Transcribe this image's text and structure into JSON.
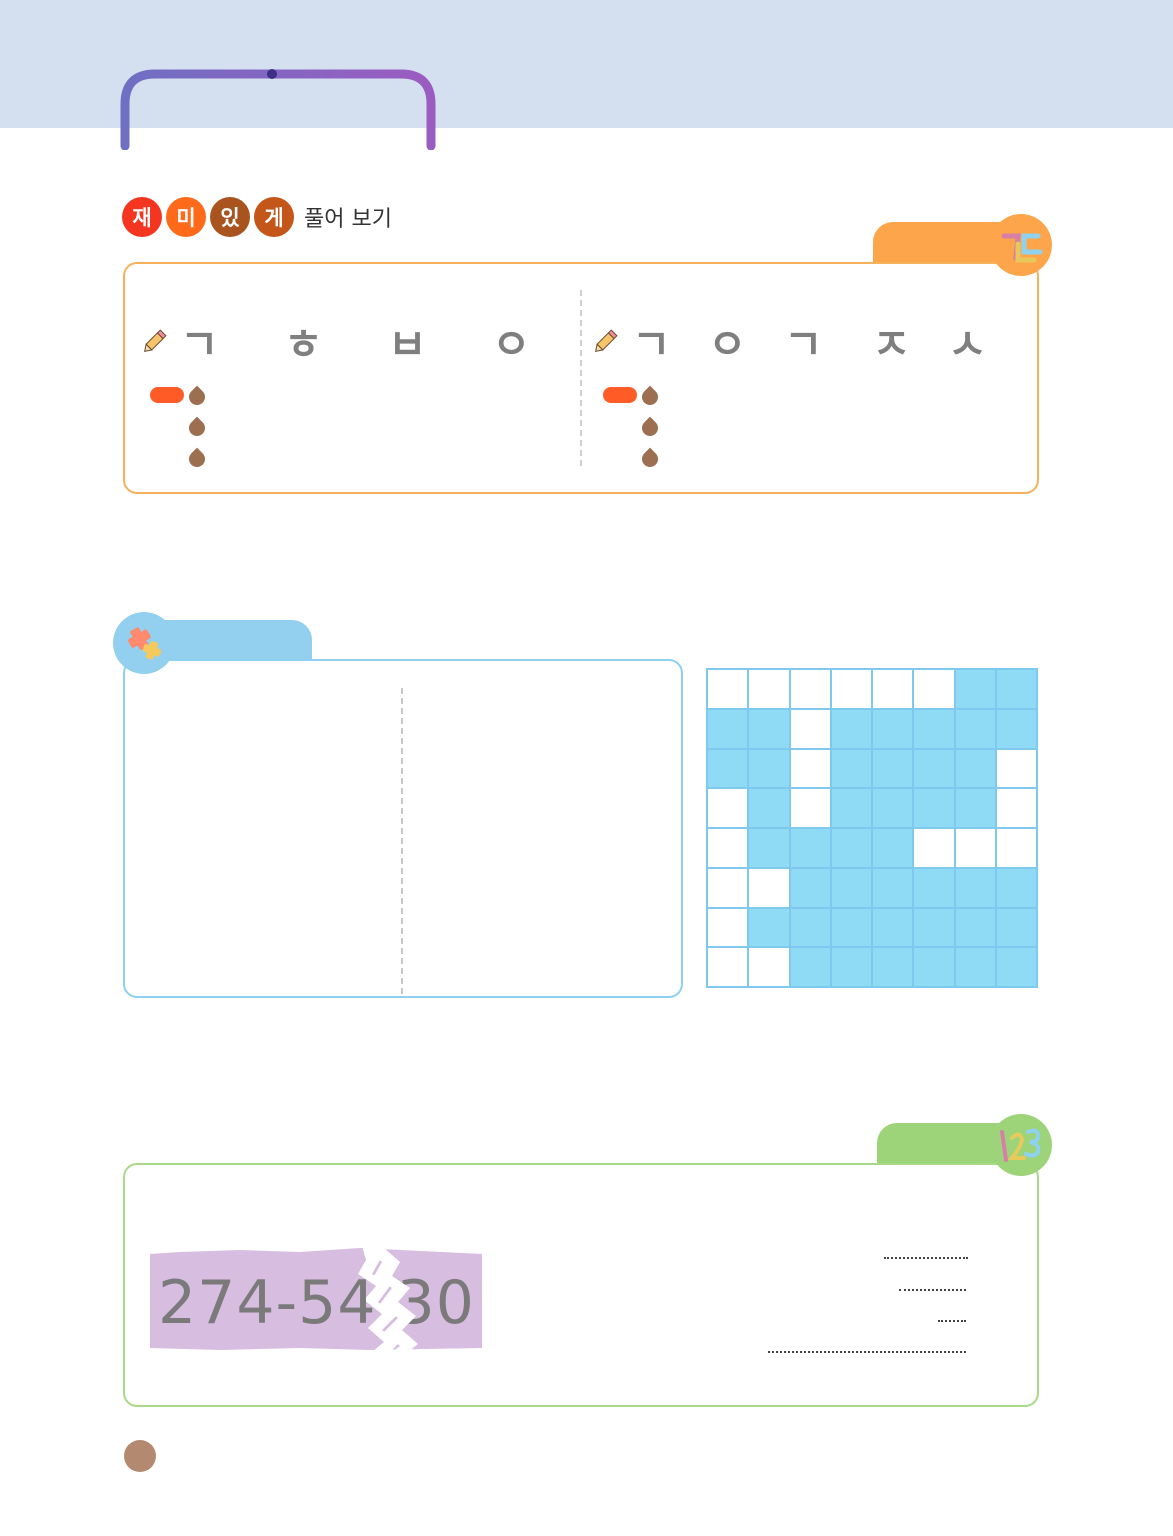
{
  "header": {
    "band_color": "#d4dff0"
  },
  "title": {
    "circles": [
      {
        "char": "재",
        "color": "#f4351f"
      },
      {
        "char": "미",
        "color": "#ff6a1a"
      },
      {
        "char": "있",
        "color": "#a9541f"
      },
      {
        "char": "게",
        "color": "#c4561a"
      }
    ],
    "tail": "풀어 보기"
  },
  "section1": {
    "accent": "#fda54a",
    "badge_icon": "korean-letters-icon",
    "badge_text": "ㄱㄷ",
    "left": {
      "letters": [
        "ㄱ",
        "ㅎ",
        "ㅂ",
        "ㅇ"
      ]
    },
    "right": {
      "letters": [
        "ㄱ",
        "ㅇ",
        "ㄱ",
        "ㅈ",
        "ㅅ"
      ]
    }
  },
  "section2": {
    "accent": "#93cfef",
    "badge_icon": "puzzle-icon",
    "grid": [
      [
        0,
        0,
        0,
        0,
        0,
        0,
        1,
        1
      ],
      [
        1,
        1,
        0,
        1,
        1,
        1,
        1,
        1
      ],
      [
        1,
        1,
        0,
        1,
        1,
        1,
        1,
        0
      ],
      [
        0,
        1,
        0,
        1,
        1,
        1,
        1,
        0
      ],
      [
        0,
        1,
        1,
        1,
        1,
        0,
        0,
        0
      ],
      [
        0,
        0,
        1,
        1,
        1,
        1,
        1,
        1
      ],
      [
        0,
        1,
        1,
        1,
        1,
        1,
        1,
        1
      ],
      [
        0,
        0,
        1,
        1,
        1,
        1,
        1,
        1
      ]
    ]
  },
  "section3": {
    "accent": "#9dd47a",
    "badge_icon": "numbers-icon",
    "badge_text": "123",
    "ticket_text": "274-54 30"
  }
}
